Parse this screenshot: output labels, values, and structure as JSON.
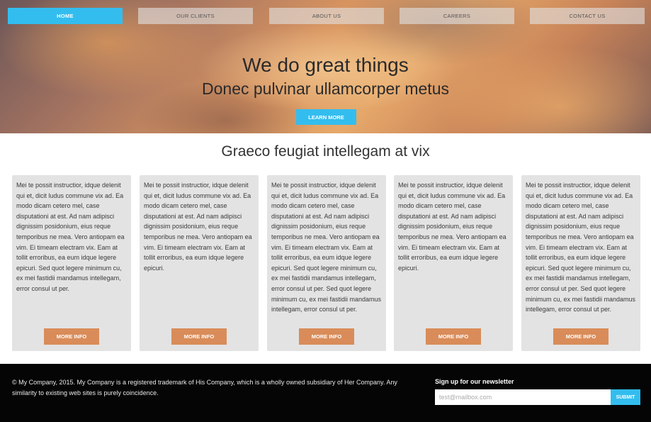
{
  "nav": {
    "items": [
      {
        "label": "HOME",
        "active": true
      },
      {
        "label": "OUR CLIENTS",
        "active": false
      },
      {
        "label": "ABOUT US",
        "active": false
      },
      {
        "label": "CAREERS",
        "active": false
      },
      {
        "label": "CONTACT US",
        "active": false
      }
    ]
  },
  "hero": {
    "title": "We do great things",
    "subtitle": "Donec pulvinar ullamcorper metus",
    "button_label": "LEARN MORE"
  },
  "section": {
    "title": "Graeco feugiat intellegam at vix"
  },
  "cards": [
    {
      "text": "Mei te possit instructior, idque delenit qui et, dicit ludus commune vix ad. Ea modo dicam cetero mel, case disputationi at est. Ad nam adipisci dignissim posidonium, eius reque temporibus ne mea. Vero antiopam ea vim. Ei timeam electram vix. Eam at tollit erroribus, ea eum idque legere epicuri. Sed quot legere minimum cu, ex mei fastidii mandamus intellegam, error consul ut per.",
      "button_label": "MORE INFO"
    },
    {
      "text": "Mei te possit instructior, idque delenit qui et, dicit ludus commune vix ad. Ea modo dicam cetero mel, case disputationi at est. Ad nam adipisci dignissim posidonium, eius reque temporibus ne mea. Vero antiopam ea vim. Ei timeam electram vix. Eam at tollit erroribus, ea eum idque legere epicuri.",
      "button_label": "MORE INFO"
    },
    {
      "text": "Mei te possit instructior, idque delenit qui et, dicit ludus commune vix ad. Ea modo dicam cetero mel, case disputationi at est. Ad nam adipisci dignissim posidonium, eius reque temporibus ne mea. Vero antiopam ea vim. Ei timeam electram vix. Eam at tollit erroribus, ea eum idque legere epicuri. Sed quot legere minimum cu, ex mei fastidii mandamus intellegam, error consul ut per. Sed quot legere minimum cu, ex mei fastidii mandamus intellegam, error consul ut per.",
      "button_label": "MORE INFO"
    },
    {
      "text": "Mei te possit instructior, idque delenit qui et, dicit ludus commune vix ad. Ea modo dicam cetero mel, case disputationi at est. Ad nam adipisci dignissim posidonium, eius reque temporibus ne mea. Vero antiopam ea vim. Ei timeam electram vix. Eam at tollit erroribus, ea eum idque legere epicuri.",
      "button_label": "MORE INFO"
    },
    {
      "text": "Mei te possit instructior, idque delenit qui et, dicit ludus commune vix ad. Ea modo dicam cetero mel, case disputationi at est. Ad nam adipisci dignissim posidonium, eius reque temporibus ne mea. Vero antiopam ea vim. Ei timeam electram vix. Eam at tollit erroribus, ea eum idque legere epicuri. Sed quot legere minimum cu, ex mei fastidii mandamus intellegam, error consul ut per. Sed quot legere minimum cu, ex mei fastidii mandamus intellegam, error consul ut per.",
      "button_label": "MORE INFO"
    }
  ],
  "footer": {
    "copyright": "© My Company, 2015. My Company is a registered trademark of His Company, which is a wholly owned subsidiary of Her Company. Any similarity to existing web sites is purely coincidence.",
    "newsletter_label": "Sign up for our newsletter",
    "email_placeholder": "test@mailbox.com",
    "email_value": "",
    "submit_label": "SUBMIT"
  },
  "colors": {
    "accent": "#33bdef",
    "card_button": "#d98c59",
    "card_background": "#e3e3e3",
    "footer_background": "#050505"
  }
}
